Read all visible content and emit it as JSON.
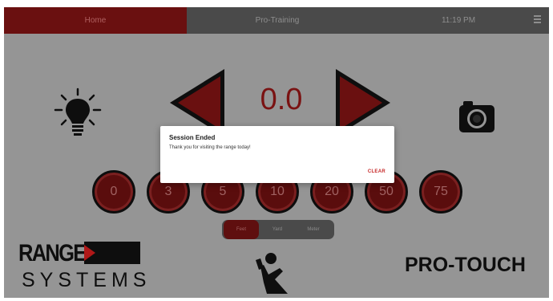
{
  "topbar": {
    "tabs": [
      {
        "label": "Home",
        "active": true
      },
      {
        "label": "Pro-Training",
        "active": false
      }
    ],
    "time": "11:19 PM",
    "menu_icon": "hamburger-menu-icon"
  },
  "controls": {
    "distance_display": "0.0",
    "left_arrow_icon": "left-triangle-icon",
    "right_arrow_icon": "right-triangle-icon",
    "light_icon": "lightbulb-icon",
    "camera_icon": "camera-icon"
  },
  "presets": [
    "0",
    "3",
    "5",
    "10",
    "20",
    "50",
    "75"
  ],
  "units": {
    "options": [
      "Feet",
      "Yard",
      "Meter"
    ],
    "selected": "Feet"
  },
  "branding": {
    "logo_top": "RANGE",
    "logo_bottom": "SYSTEMS",
    "product": "PRO-TOUCH",
    "person_icon": "person-waving-icon"
  },
  "dialog": {
    "title": "Session Ended",
    "message": "Thank you for visiting the range today!",
    "button": "CLEAR"
  },
  "colors": {
    "accent_red": "#6a1010",
    "dialog_button": "#c62828",
    "background": "#959595",
    "topbar": "#4a4a4a"
  }
}
